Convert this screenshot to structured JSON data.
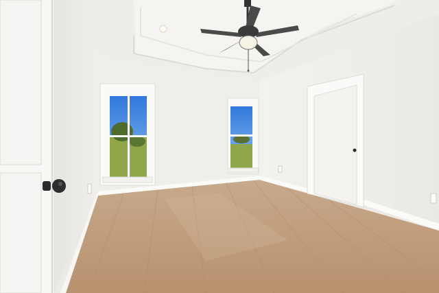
{
  "scene": {
    "description_kind": "photo",
    "palette": {
      "wall_light": "#f1f0ec",
      "wall_shadow": "#e2e0db",
      "trim": "#fafaf8",
      "floor_light": "#c9a989",
      "floor_dark": "#a8876a",
      "sky": "#3f86e0",
      "grass": "#8fa64a",
      "trees": "#4f6b2e",
      "fan_blade": "#4a4a4a",
      "door_knob": "#2a2a2a"
    },
    "objects": [
      "ceiling-fan",
      "recessed-light",
      "tray-ceiling",
      "window-left",
      "window-right",
      "interior-door",
      "foreground-door",
      "hardwood-floor",
      "baseboard",
      "wall-outlet"
    ]
  }
}
